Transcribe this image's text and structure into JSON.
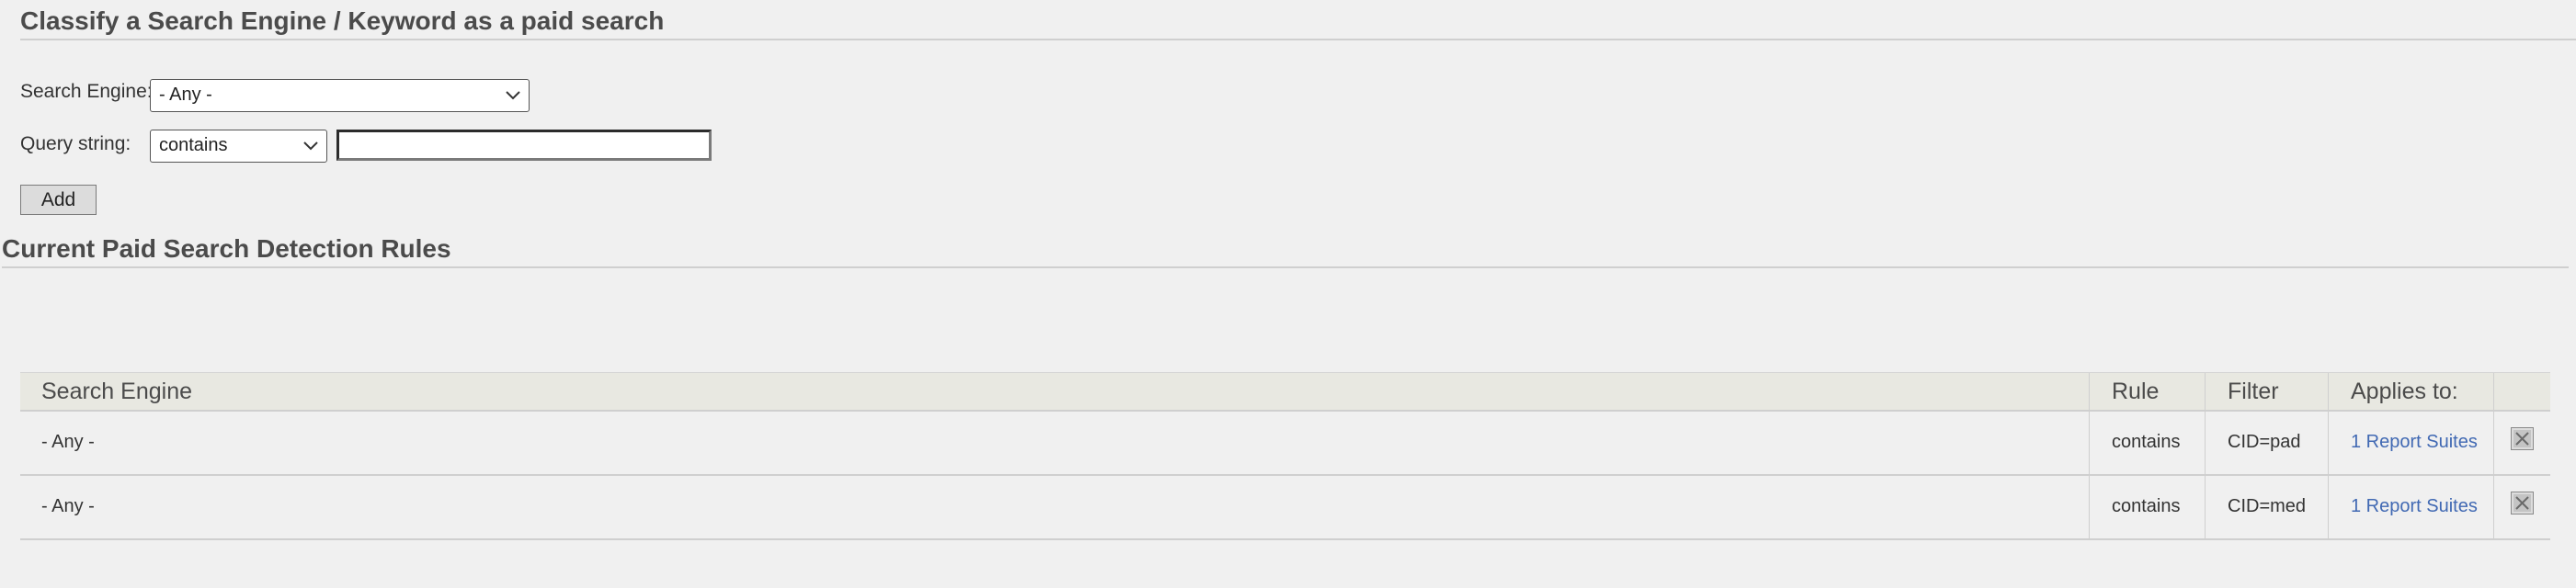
{
  "sections": {
    "classify_title": "Classify a Search Engine / Keyword as a paid search",
    "rules_title": "Current Paid Search Detection Rules"
  },
  "form": {
    "engine_label": "Search Engine:",
    "engine_selected": "- Any -",
    "query_label": "Query string:",
    "rule_selected": "contains",
    "query_value": "",
    "add_label": "Add"
  },
  "table": {
    "headers": {
      "engine": "Search Engine",
      "rule": "Rule",
      "filter": "Filter",
      "applies": "Applies to:"
    },
    "rows": [
      {
        "engine": "- Any -",
        "rule": "contains",
        "filter": "CID=pad",
        "applies": "1 Report Suites"
      },
      {
        "engine": "- Any -",
        "rule": "contains",
        "filter": "CID=med",
        "applies": "1 Report Suites"
      }
    ]
  },
  "icons": {
    "dropdown": "chevron-down-icon",
    "delete": "delete-x-icon"
  },
  "colors": {
    "background": "#f0f0f0",
    "link": "#4169b3",
    "header_row": "#e8e8e1"
  }
}
